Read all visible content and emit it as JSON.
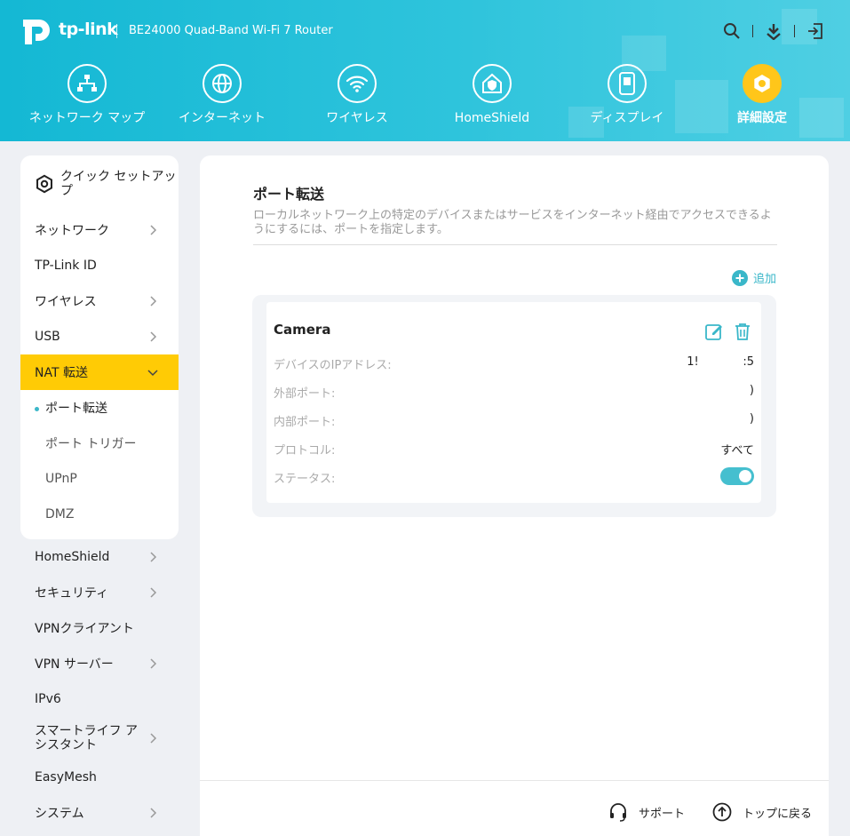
{
  "header": {
    "brand": "tp-link",
    "model": "BE24000 Quad-Band Wi-Fi 7 Router",
    "icons": [
      "search-icon",
      "download-icon",
      "logout-icon"
    ]
  },
  "nav": [
    {
      "label": "ネットワーク マップ",
      "icon": "network-map-icon"
    },
    {
      "label": "インターネット",
      "icon": "globe-icon"
    },
    {
      "label": "ワイヤレス",
      "icon": "wifi-icon"
    },
    {
      "label": "HomeShield",
      "icon": "shield-home-icon"
    },
    {
      "label": "ディスプレイ",
      "icon": "display-icon"
    },
    {
      "label": "詳細設定",
      "icon": "gear-icon",
      "active": true
    }
  ],
  "sidebar": {
    "quick": "クイック セットアップ",
    "items_top": [
      "ネットワーク",
      "TP-Link ID",
      "ワイヤレス",
      "USB"
    ],
    "active": "NAT 転送",
    "sub": [
      "ポート転送",
      "ポート トリガー",
      "UPnP",
      "DMZ"
    ],
    "items_rest": [
      "HomeShield",
      "セキュリティ",
      "VPNクライアント",
      "VPN サーバー",
      "IPv6",
      "スマートライフ アシスタント",
      "EasyMesh",
      "システム"
    ]
  },
  "main": {
    "title": "ポート転送",
    "description": "ローカルネットワーク上の特定のデバイスまたはサービスをインターネット経由でアクセスできるようにするには、ポートを指定します。",
    "add_label": "追加",
    "card": {
      "name": "Camera",
      "rows": [
        {
          "key": "デバイスのIPアドレス:",
          "value": "1!            :5"
        },
        {
          "key": "外部ポート:",
          "value": ")"
        },
        {
          "key": "内部ポート:",
          "value": ")"
        },
        {
          "key": "プロトコル:",
          "value": "すべて"
        },
        {
          "key": "ステータス:",
          "value": "on"
        }
      ]
    }
  },
  "footer": {
    "support": "サポート",
    "back_to_top": "トップに戻る"
  },
  "colors": {
    "header": "#2fc4dc",
    "active_yellow": "#ffcb05",
    "accent": "#3ab7c9"
  }
}
